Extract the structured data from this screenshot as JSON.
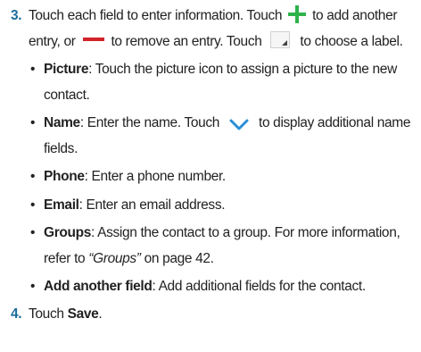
{
  "step3": {
    "number": "3.",
    "text_a": "Touch each field to enter information. Touch ",
    "add_icon": "plus-icon",
    "text_b": " to add another entry, or ",
    "remove_icon": "minus-icon",
    "text_c": " to remove an entry. Touch ",
    "label_icon": "dropdown-corner-icon",
    "text_d": " to choose a label.",
    "bullets": [
      {
        "term": "Picture",
        "sep": ": ",
        "desc": "Touch the picture icon to assign a picture to the new contact."
      },
      {
        "term": "Name",
        "sep": ": ",
        "desc_a": "Enter the name. Touch ",
        "icon": "chevron-down-icon",
        "desc_b": " to display additional name fields."
      },
      {
        "term": "Phone",
        "sep": ": ",
        "desc": "Enter a phone number."
      },
      {
        "term": "Email",
        "sep": ": ",
        "desc": "Enter an email address."
      },
      {
        "term": "Groups",
        "sep": ": ",
        "desc_a": "Assign the contact to a group. For more information, refer to ",
        "ref": "“Groups”",
        "desc_b": " on page 42."
      },
      {
        "term": "Add another field",
        "sep": ": ",
        "desc": "Add additional fields for the contact."
      }
    ]
  },
  "step4": {
    "number": "4.",
    "text": "Touch ",
    "action": "Save",
    "end": "."
  },
  "colors": {
    "step_number": "#1b6d9c",
    "add_icon": "#2db34a",
    "remove_icon": "#d2232a",
    "chevron_icon": "#2a8fd6",
    "text": "#222222"
  }
}
